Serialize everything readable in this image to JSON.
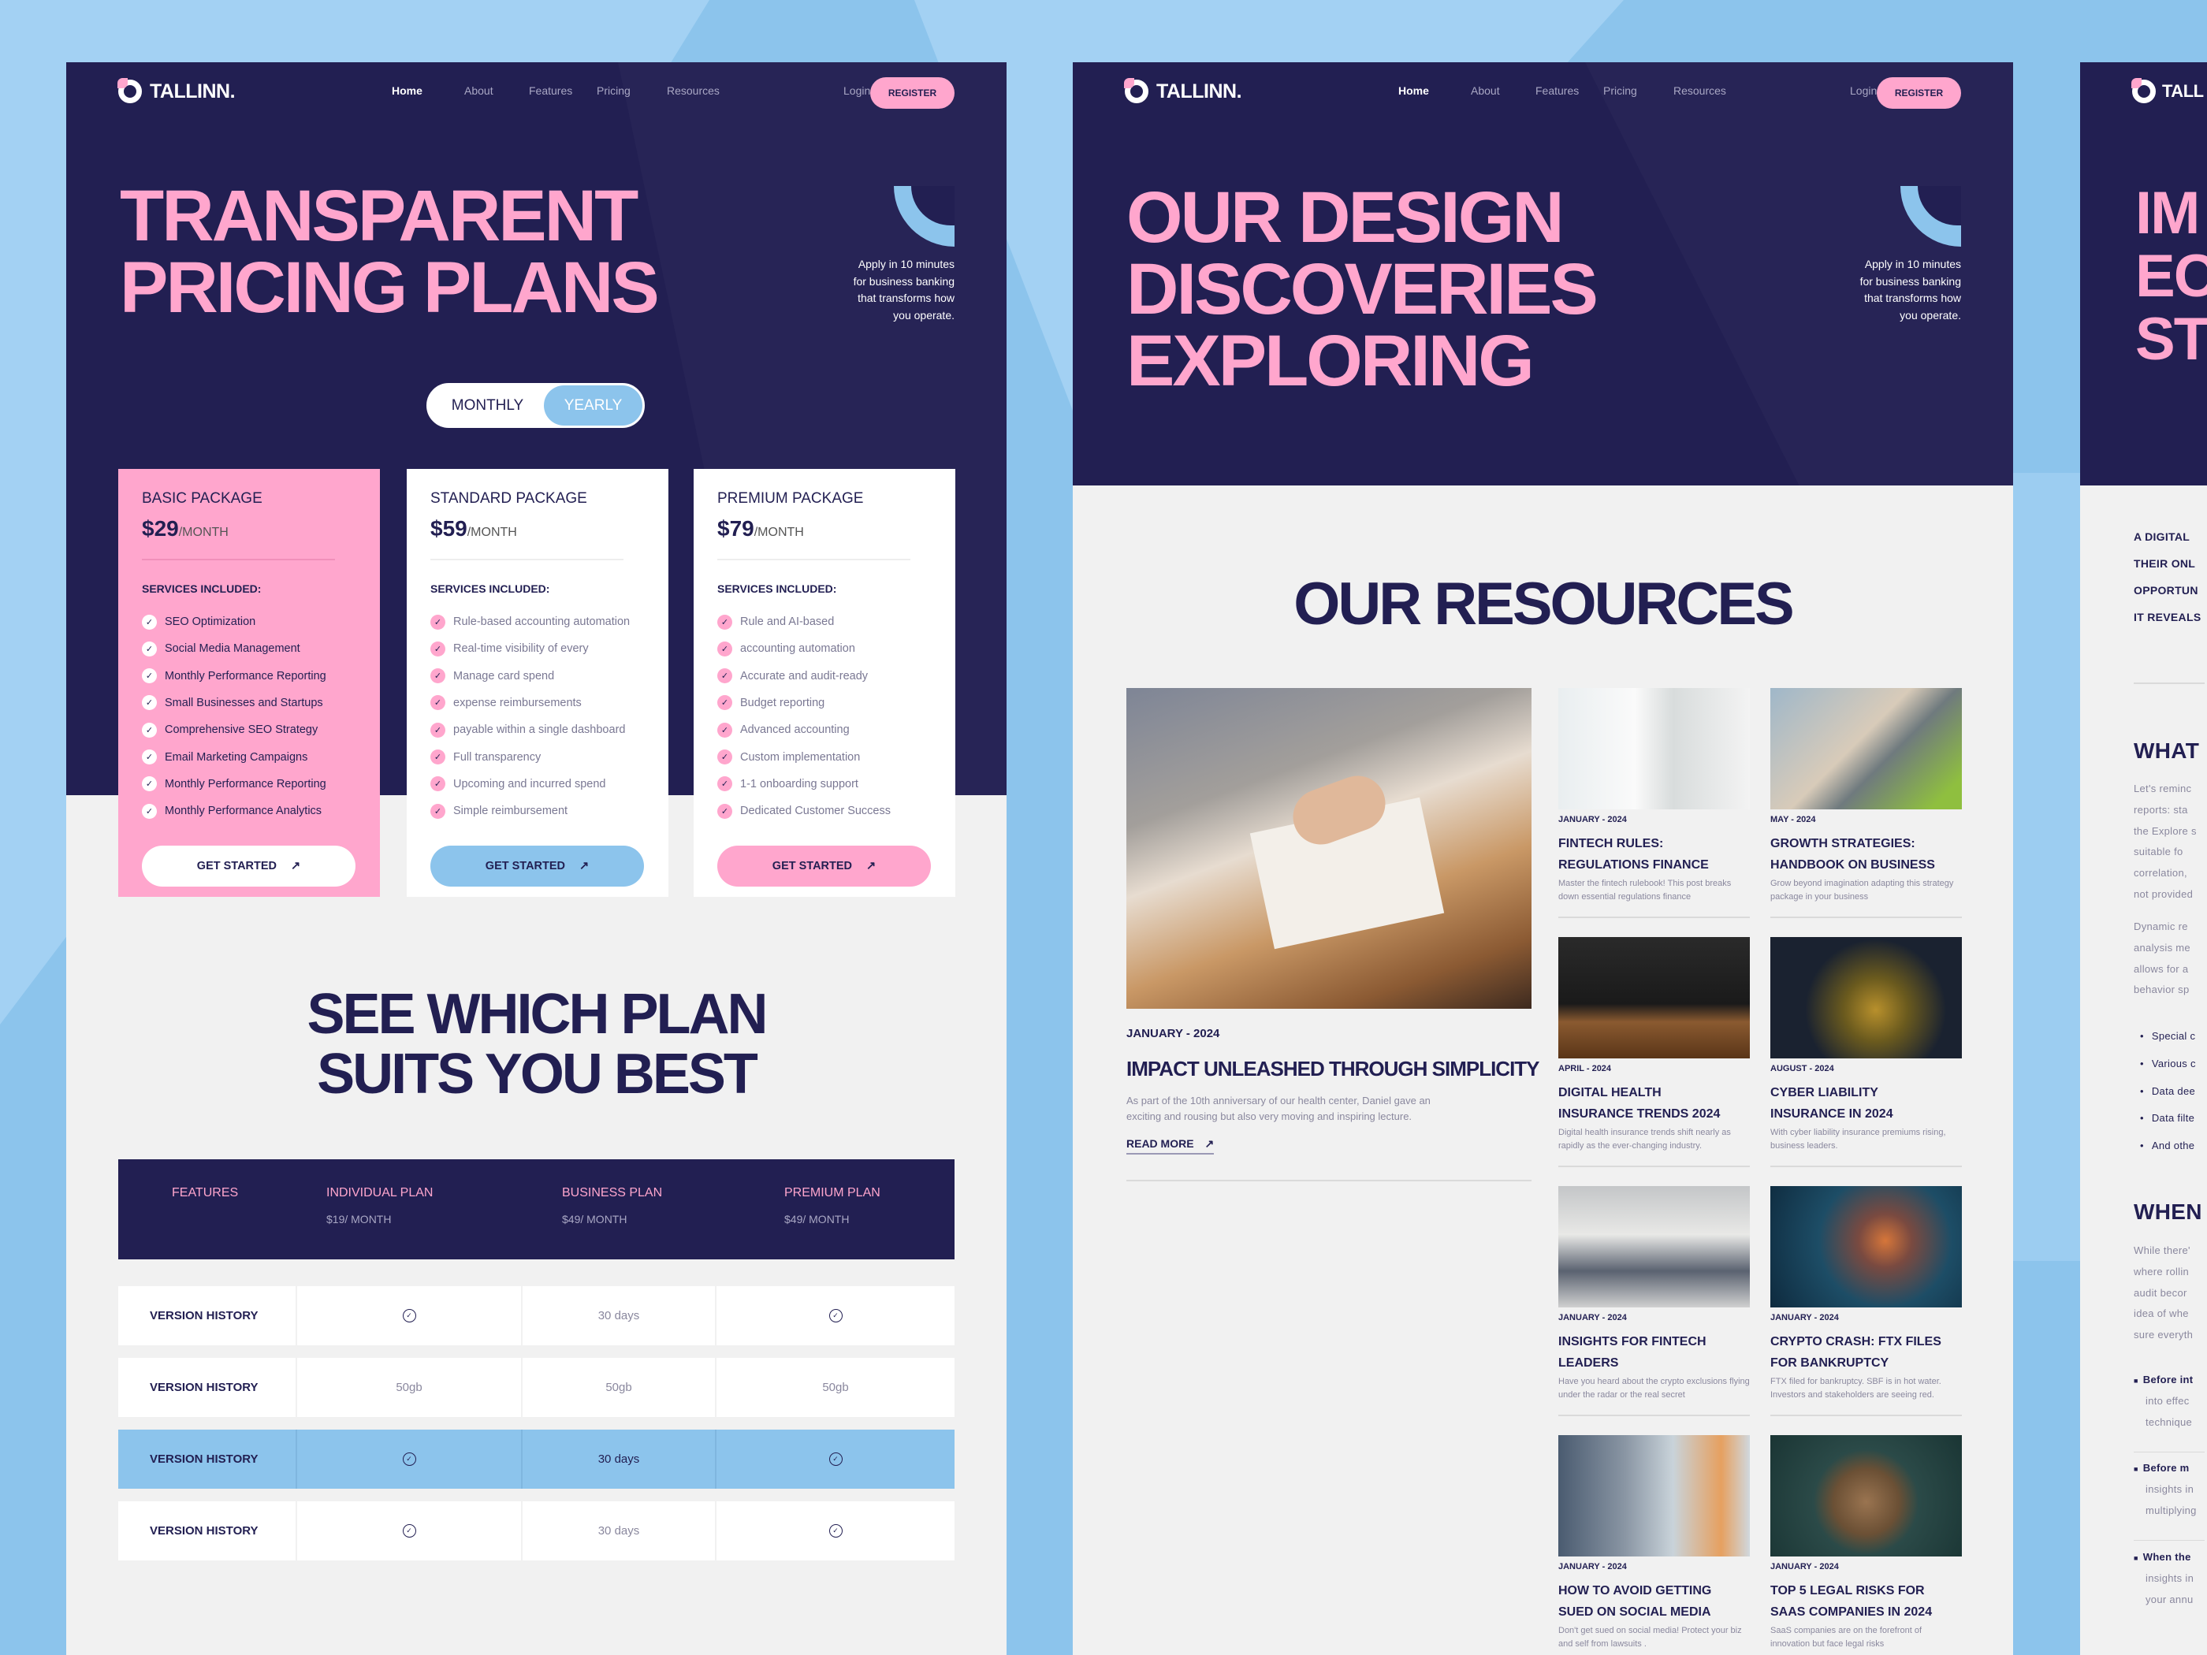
{
  "colors": {
    "navy": "#221f52",
    "pink": "#ffa6cd",
    "blue": "#8cc4ec",
    "light": "#f1f1f1"
  },
  "brand": {
    "name": "TALLINN.",
    "icon": "logo-ring-icon"
  },
  "nav": {
    "items": [
      "Home",
      "About",
      "Features",
      "Pricing",
      "Resources"
    ],
    "active": "Home",
    "login": "Login",
    "register": "REGISTER"
  },
  "hero_note": [
    "Apply in 10 minutes",
    "for business banking",
    "that transforms how",
    "you operate."
  ],
  "pricing_page": {
    "title": [
      "TRANSPARENT",
      "PRICING PLANS"
    ],
    "toggle": {
      "options": [
        "MONTHLY",
        "YEARLY"
      ],
      "selected": "YEARLY"
    },
    "cards": [
      {
        "name": "BASIC PACKAGE",
        "price": "$29",
        "period": "/MONTH",
        "services_label": "SERVICES INCLUDED:",
        "items": [
          "SEO Optimization",
          "Social Media Management",
          "Monthly Performance Reporting",
          "Small Businesses and Startups",
          "Comprehensive SEO Strategy",
          "Email Marketing Campaigns",
          "Monthly Performance Reporting",
          "Monthly Performance Analytics"
        ],
        "button": "GET STARTED"
      },
      {
        "name": "STANDARD PACKAGE",
        "price": "$59",
        "period": "/MONTH",
        "services_label": "SERVICES INCLUDED:",
        "items": [
          "Rule-based accounting automation",
          "Real-time visibility of every",
          "Manage card spend",
          "expense reimbursements",
          "payable within a single dashboard",
          "Full transparency",
          "Upcoming and incurred spend",
          "Simple reimbursement"
        ],
        "button": "GET STARTED"
      },
      {
        "name": "PREMIUM PACKAGE",
        "price": "$79",
        "period": "/MONTH",
        "services_label": "SERVICES INCLUDED:",
        "items": [
          "Rule and AI-based",
          "accounting automation",
          "Accurate and audit-ready",
          "Budget reporting",
          "Advanced accounting",
          "Custom implementation",
          "1-1 onboarding support",
          "Dedicated Customer Success"
        ],
        "button": "GET STARTED"
      }
    ],
    "compare_title": [
      "SEE WHICH PLAN",
      "SUITS YOU BEST"
    ],
    "table": {
      "headers": [
        {
          "label": "FEATURES",
          "sub": ""
        },
        {
          "label": "INDIVIDUAL PLAN",
          "sub": "$19/ MONTH"
        },
        {
          "label": "BUSINESS PLAN",
          "sub": "$49/ MONTH"
        },
        {
          "label": "PREMIUM PLAN",
          "sub": "$49/ MONTH"
        }
      ],
      "rows": [
        {
          "feature": "VERSION HISTORY",
          "values": [
            "check",
            "30 days",
            "check"
          ],
          "highlighted": false
        },
        {
          "feature": "VERSION HISTORY",
          "values": [
            "50gb",
            "50gb",
            "50gb"
          ],
          "highlighted": false
        },
        {
          "feature": "VERSION HISTORY",
          "values": [
            "check",
            "30 days",
            "check"
          ],
          "highlighted": true
        },
        {
          "feature": "VERSION HISTORY",
          "values": [
            "check",
            "30 days",
            "check"
          ],
          "highlighted": false
        }
      ]
    }
  },
  "resources_page": {
    "title": [
      "OUR DESIGN",
      "DISCOVERIES",
      "EXPLORING"
    ],
    "section_title": "OUR RESOURCES",
    "featured": {
      "date": "JANUARY - 2024",
      "title": "IMPACT UNLEASHED THROUGH SIMPLICITY",
      "desc": [
        "As part of the 10th anniversary of our health center, Daniel gave an",
        "exciting and rousing but also very moving and inspiring lecture."
      ],
      "link": "READ MORE"
    },
    "posts": [
      {
        "date": "JANUARY - 2024",
        "title": [
          "FINTECH RULES:",
          "REGULATIONS FINANCE"
        ],
        "desc": "Master the fintech rulebook! This post breaks down essential regulations finance",
        "image": "businesswoman-office"
      },
      {
        "date": "MAY - 2024",
        "title": [
          "GROWTH STRATEGIES:",
          "HANDBOOK ON BUSINESS"
        ],
        "desc": "Grow beyond imagination adapting this strategy package in your business",
        "image": "hands-laptop"
      },
      {
        "date": "APRIL - 2024",
        "title": [
          "DIGITAL HEALTH",
          "INSURANCE TRENDS 2024"
        ],
        "desc": "Digital health insurance trends shift nearly as rapidly as the ever-changing industry.",
        "image": "typing-laptop-dark"
      },
      {
        "date": "AUGUST - 2024",
        "title": [
          "CYBER LIABILITY",
          "INSURANCE IN 2024"
        ],
        "desc": "With cyber liability insurance premiums rising, business leaders.",
        "image": "hacker-hoodie"
      },
      {
        "date": "JANUARY - 2024",
        "title": [
          "INSIGHTS FOR FINTECH",
          "LEADERS"
        ],
        "desc": "Have you heard about the crypto exclusions flying under the radar or the real secret",
        "image": "office-desks"
      },
      {
        "date": "JANUARY - 2024",
        "title": [
          "CRYPTO CRASH: FTX FILES",
          "FOR BANKRUPTCY"
        ],
        "desc": "FTX filed for bankruptcy. SBF is in hot water. Investors and stakeholders are seeing red.",
        "image": "woman-holographic"
      },
      {
        "date": "JANUARY - 2024",
        "title": [
          "HOW TO AVOID GETTING",
          "SUED ON SOCIAL MEDIA"
        ],
        "desc": "Don't get sued on social media! Protect your biz and self from lawsuits .",
        "image": "man-vr-headset"
      },
      {
        "date": "JANUARY - 2024",
        "title": [
          "TOP 5 LEGAL RISKS FOR",
          "SAAS COMPANIES IN 2024"
        ],
        "desc": "SaaS companies are on the forefront of innovation but face legal risks",
        "image": "desk-top-view"
      }
    ]
  },
  "article_page": {
    "brand_fragment": "TALL",
    "title": [
      "IM",
      "EC",
      "ST"
    ],
    "intro": [
      "A DIGITAL",
      "THEIR ONL",
      "OPPORTUN",
      "IT REVEALS"
    ],
    "h1": "WHAT",
    "p1": [
      "Let's reminc",
      "reports: sta",
      "the Explore s",
      "suitable fo",
      "correlation,",
      "not provided"
    ],
    "p2": [
      "Dynamic re",
      "analysis me",
      "allows for a",
      "behavior sp"
    ],
    "bullets": [
      "Special c",
      "Various c",
      "Data dee",
      "Data filte",
      "And othe"
    ],
    "h2": "WHEN",
    "p3": [
      "While there'",
      "where rollin",
      "audit becor",
      "idea of whe",
      "sure everyth"
    ],
    "items": [
      {
        "bold": "Before int",
        "lines": [
          "into effec",
          "technique"
        ]
      },
      {
        "bold": "Before m",
        "lines": [
          "insights in",
          "multiplying"
        ]
      },
      {
        "bold": "When the",
        "lines": [
          "insights in",
          "your annu"
        ]
      }
    ]
  }
}
